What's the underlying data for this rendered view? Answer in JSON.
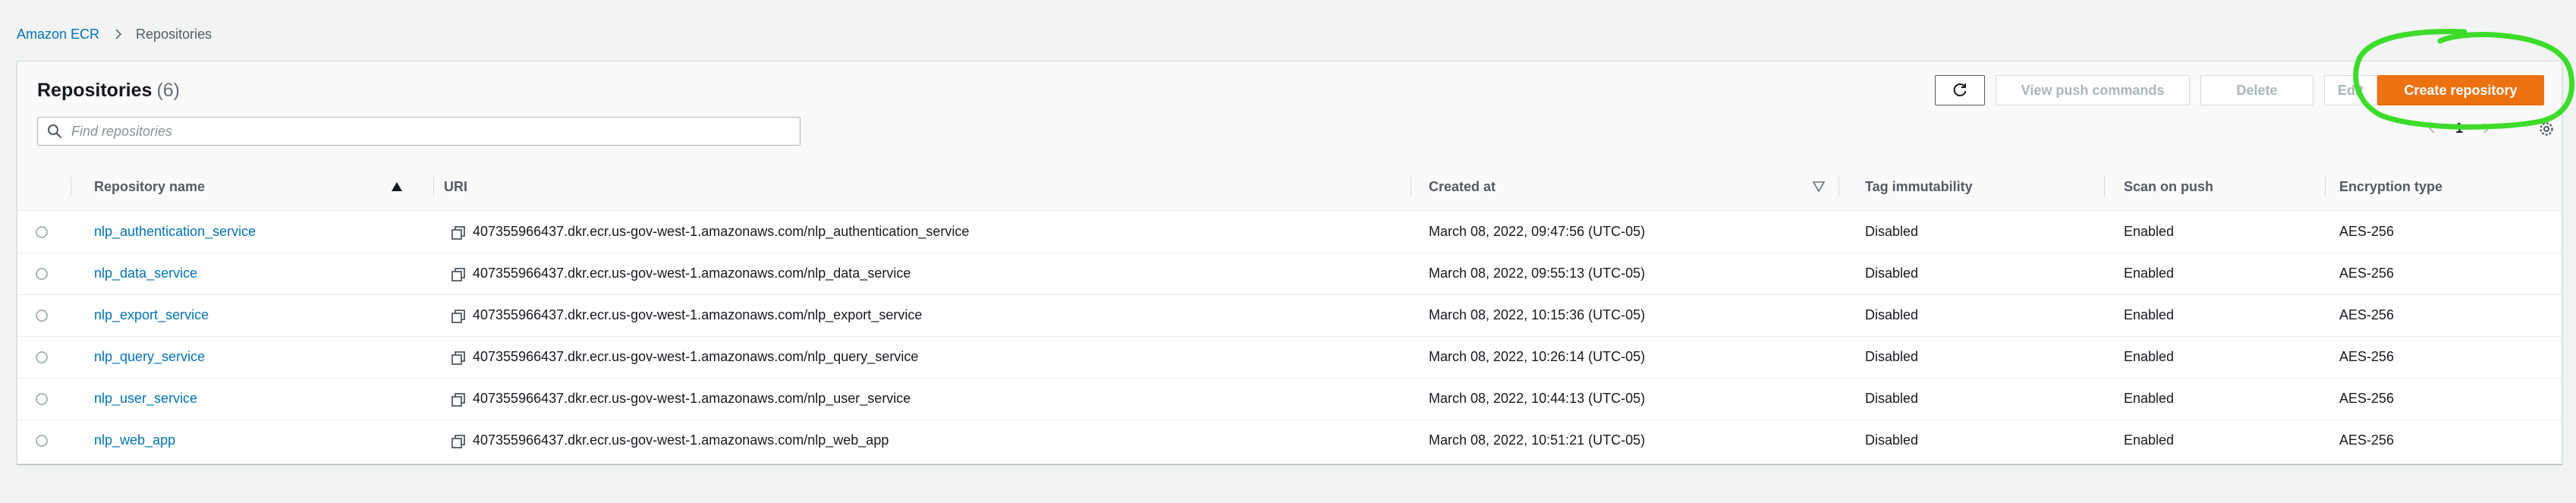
{
  "breadcrumb": {
    "root": "Amazon ECR",
    "current": "Repositories"
  },
  "header": {
    "title": "Repositories",
    "count": "(6)"
  },
  "search": {
    "placeholder": "Find repositories",
    "value": ""
  },
  "buttons": {
    "view_push": "View push commands",
    "delete": "Delete",
    "edit": "Edit",
    "create": "Create repository"
  },
  "pagination": {
    "current_page": "1"
  },
  "columns": {
    "name": "Repository name",
    "uri": "URI",
    "created": "Created at",
    "tag": "Tag immutability",
    "scan": "Scan on push",
    "encryption": "Encryption type"
  },
  "rows": [
    {
      "name": "nlp_authentication_service",
      "uri": "407355966437.dkr.ecr.us-gov-west-1.amazonaws.com/nlp_authentication_service",
      "created": "March 08, 2022, 09:47:56 (UTC-05)",
      "tag": "Disabled",
      "scan": "Enabled",
      "encryption": "AES-256"
    },
    {
      "name": "nlp_data_service",
      "uri": "407355966437.dkr.ecr.us-gov-west-1.amazonaws.com/nlp_data_service",
      "created": "March 08, 2022, 09:55:13 (UTC-05)",
      "tag": "Disabled",
      "scan": "Enabled",
      "encryption": "AES-256"
    },
    {
      "name": "nlp_export_service",
      "uri": "407355966437.dkr.ecr.us-gov-west-1.amazonaws.com/nlp_export_service",
      "created": "March 08, 2022, 10:15:36 (UTC-05)",
      "tag": "Disabled",
      "scan": "Enabled",
      "encryption": "AES-256"
    },
    {
      "name": "nlp_query_service",
      "uri": "407355966437.dkr.ecr.us-gov-west-1.amazonaws.com/nlp_query_service",
      "created": "March 08, 2022, 10:26:14 (UTC-05)",
      "tag": "Disabled",
      "scan": "Enabled",
      "encryption": "AES-256"
    },
    {
      "name": "nlp_user_service",
      "uri": "407355966437.dkr.ecr.us-gov-west-1.amazonaws.com/nlp_user_service",
      "created": "March 08, 2022, 10:44:13 (UTC-05)",
      "tag": "Disabled",
      "scan": "Enabled",
      "encryption": "AES-256"
    },
    {
      "name": "nlp_web_app",
      "uri": "407355966437.dkr.ecr.us-gov-west-1.amazonaws.com/nlp_web_app",
      "created": "March 08, 2022, 10:51:21 (UTC-05)",
      "tag": "Disabled",
      "scan": "Enabled",
      "encryption": "AES-256"
    }
  ],
  "icons": {
    "breadcrumb_separator": "chevron-right-icon",
    "refresh": "refresh-icon",
    "search": "search-icon",
    "settings": "gear-icon",
    "copy": "copy-icon",
    "sort_asc": "sort-ascending-icon",
    "sort_desc": "sort-descending-icon"
  },
  "colors": {
    "primary_button": "#ec7211",
    "link": "#0073bb",
    "annotation": "#3ddc2a",
    "background": "#f2f3f3"
  }
}
